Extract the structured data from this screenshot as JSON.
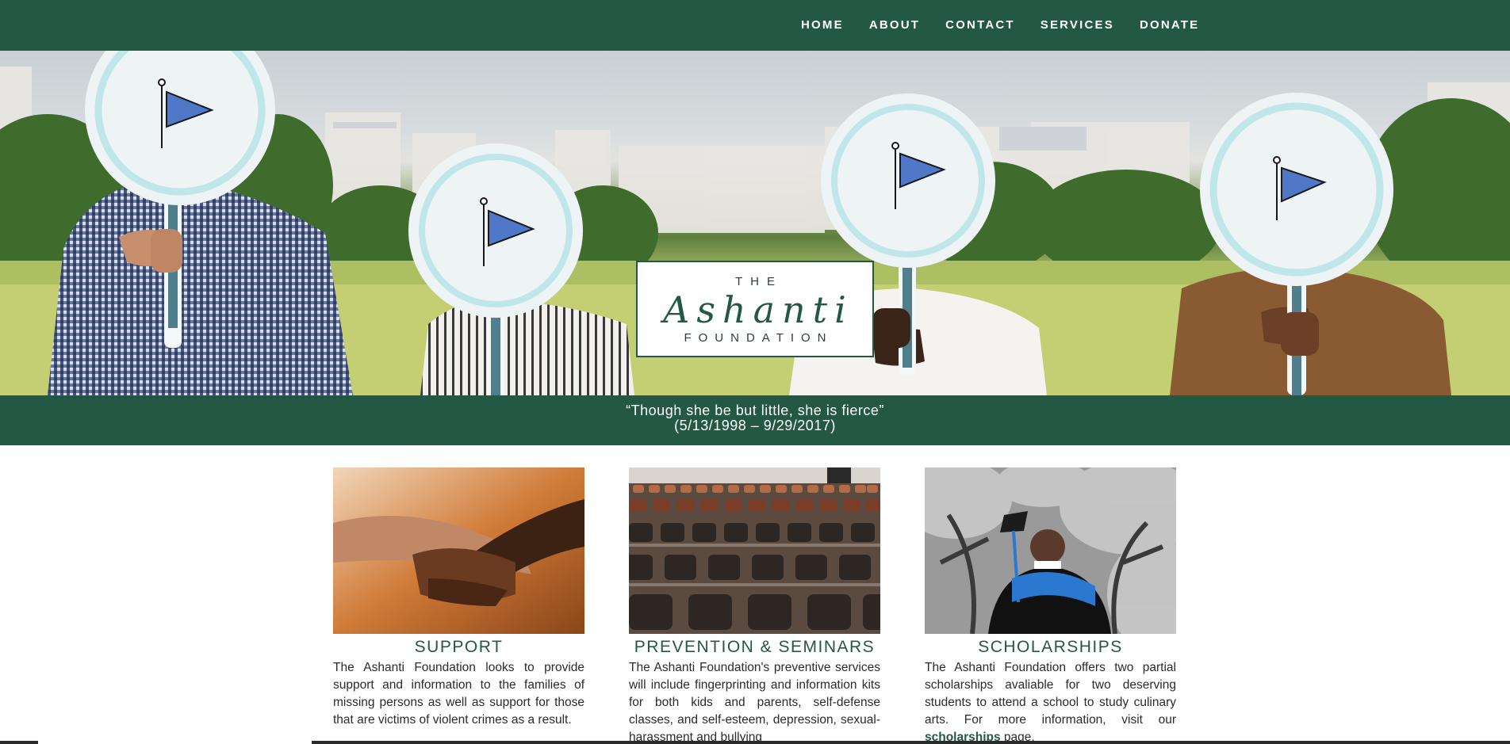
{
  "nav": {
    "items": [
      "HOME",
      "ABOUT",
      "CONTACT",
      "SERVICES",
      "DONATE"
    ]
  },
  "hero": {
    "logo": {
      "the": "THE",
      "name": "Ashanti",
      "foundation": "FOUNDATION"
    }
  },
  "quote": {
    "line1": "“Though she be but little, she is fierce”",
    "line2": "(5/13/1998 – 9/29/2017)"
  },
  "cards": [
    {
      "title": "SUPPORT",
      "text": "The Ashanti Foundation looks to provide support and information to the families of missing persons as well as support for those that are victims of violent crimes as a result."
    },
    {
      "title": "PREVENTION & SEMINARS",
      "text": "The Ashanti Foundation's preventive services will include fingerprinting and information kits for both kids and parents, self-defense classes, and self-esteem, depression, sexual-harassment and bullying"
    },
    {
      "title": "SCHOLARSHIPS",
      "text_before": "The Ashanti Foundation offers two partial scholarships avaliable for two deserving students to attend a school to study culinary arts. For more information, visit our ",
      "link": "scholarships",
      "text_after": " page."
    }
  ],
  "colors": {
    "brand_green": "#235844",
    "flag_blue": "#4f78c9",
    "sign_ring": "#bfe6e8"
  },
  "icons": [
    "flag-icon"
  ]
}
